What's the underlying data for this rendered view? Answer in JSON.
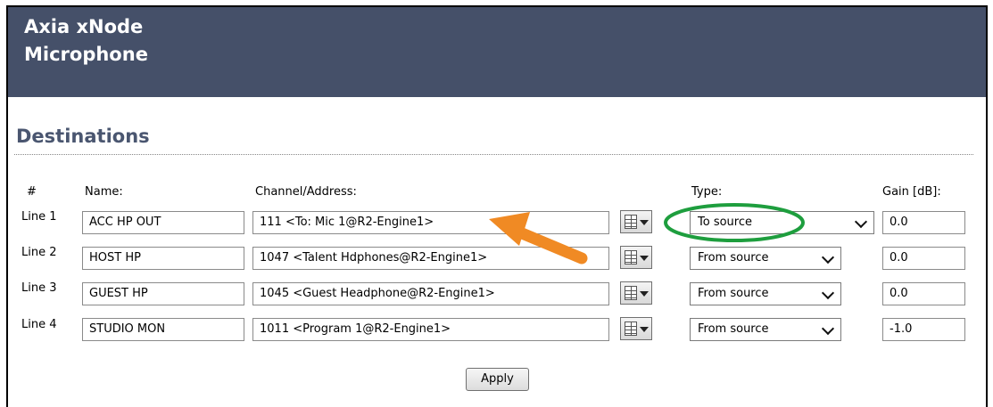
{
  "header": {
    "line1": "Axia xNode",
    "line2": "Microphone"
  },
  "section_title": "Destinations",
  "columns": {
    "num": "#",
    "name": "Name:",
    "channel": "Channel/Address:",
    "type": "Type:",
    "gain": "Gain [dB]:"
  },
  "rows": [
    {
      "label": "Line 1",
      "name": "ACC HP OUT",
      "channel": "111 <To: Mic 1@R2-Engine1>",
      "type": "To source",
      "gain": "0.0"
    },
    {
      "label": "Line 2",
      "name": "HOST HP",
      "channel": "1047 <Talent Hdphones@R2-Engine1>",
      "type": "From source",
      "gain": "0.0"
    },
    {
      "label": "Line 3",
      "name": "GUEST HP",
      "channel": "1045 <Guest Headphone@R2-Engine1>",
      "type": "From source",
      "gain": "0.0"
    },
    {
      "label": "Line 4",
      "name": "STUDIO MON",
      "channel": "1011 <Program 1@R2-Engine1>",
      "type": "From source",
      "gain": "-1.0"
    }
  ],
  "apply_label": "Apply",
  "colors": {
    "header_bg": "#455069",
    "arrow": "#F08A24",
    "highlight_circle": "#1E9E3E"
  }
}
